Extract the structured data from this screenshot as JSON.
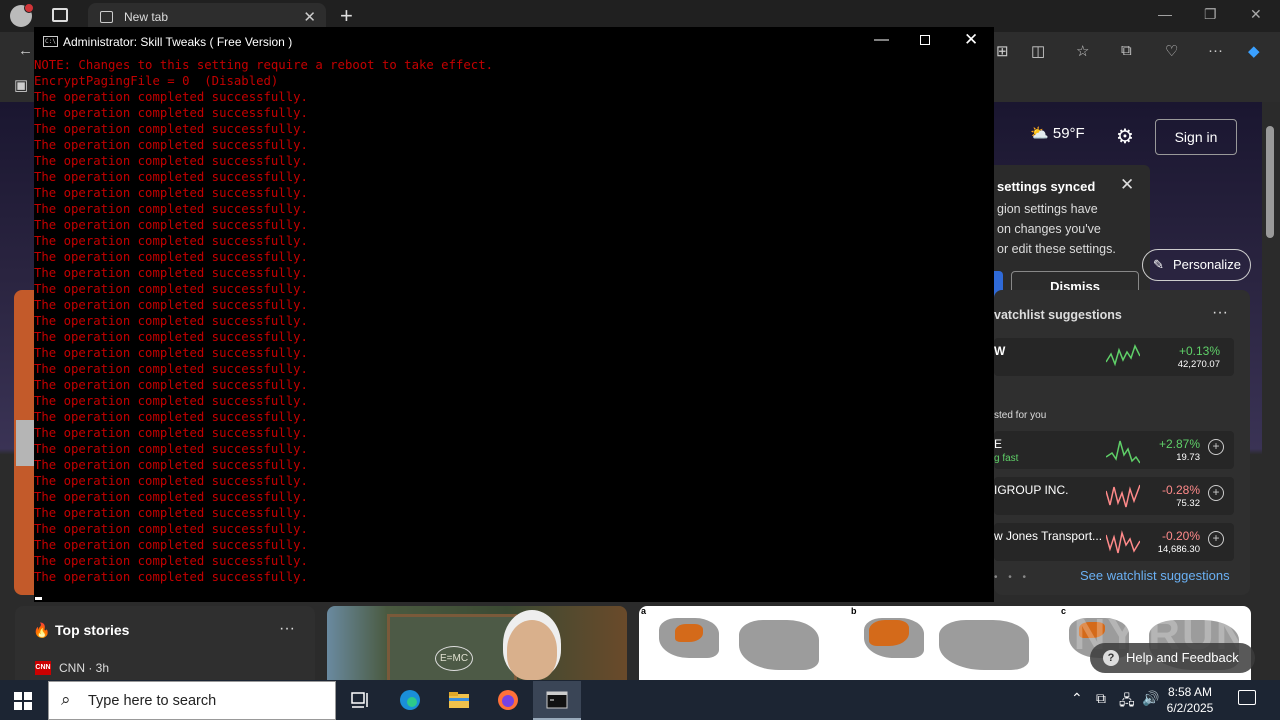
{
  "browser": {
    "tab_title": "New tab"
  },
  "ntp": {
    "weather_temp": "59°F",
    "signin_label": "Sign in",
    "popup": {
      "title_partial": "settings synced",
      "line1": "gion settings have",
      "line2": "on changes you've",
      "line3": " or edit these settings.",
      "dismiss_label": "Dismiss"
    },
    "personalize_label": "Personalize",
    "watchlist": {
      "title_partial": "vatchlist suggestions",
      "suggested_label": "sted for you",
      "see_more": "See watchlist suggestions",
      "items": [
        {
          "name": "W",
          "sub": "",
          "change": "+0.13%",
          "value": "42,270.07",
          "color": "#5fd068"
        },
        {
          "name": "E",
          "sub": "g fast",
          "change": "+2.87%",
          "value": "19.73",
          "color": "#5fd068"
        },
        {
          "name": "IGROUP INC.",
          "sub": "",
          "change": "-0.28%",
          "value": "75.32",
          "color": "#ff8a8a"
        },
        {
          "name": "w Jones Transport...",
          "sub": "",
          "change": "-0.20%",
          "value": "14,686.30",
          "color": "#ff8a8a"
        }
      ]
    },
    "top_stories": {
      "title": "Top stories",
      "source": "CNN · 3h",
      "source_logo": "CNN"
    },
    "einstein_text": "E=MC",
    "map_labels": [
      "a",
      "b",
      "c"
    ],
    "help_label": "Help and Feedback",
    "watermark": "ANY.RUN"
  },
  "console": {
    "title": "Administrator:  Skill Tweaks ( Free Version )",
    "icon_text": "C:\\",
    "lines": [
      "NOTE: Changes to this setting require a reboot to take effect.",
      "EncryptPagingFile = 0  (Disabled)",
      "The operation completed successfully.",
      "The operation completed successfully.",
      "The operation completed successfully.",
      "The operation completed successfully.",
      "The operation completed successfully.",
      "The operation completed successfully.",
      "The operation completed successfully.",
      "The operation completed successfully.",
      "The operation completed successfully.",
      "The operation completed successfully.",
      "The operation completed successfully.",
      "The operation completed successfully.",
      "The operation completed successfully.",
      "The operation completed successfully.",
      "The operation completed successfully.",
      "The operation completed successfully.",
      "The operation completed successfully.",
      "The operation completed successfully.",
      "The operation completed successfully.",
      "The operation completed successfully.",
      "The operation completed successfully.",
      "The operation completed successfully.",
      "The operation completed successfully.",
      "The operation completed successfully.",
      "The operation completed successfully.",
      "The operation completed successfully.",
      "The operation completed successfully.",
      "The operation completed successfully.",
      "The operation completed successfully.",
      "The operation completed successfully.",
      "The operation completed successfully."
    ],
    "text_color": "#c40000"
  },
  "taskbar": {
    "search_placeholder": "Type here to search",
    "time": "8:58 AM",
    "date": "6/2/2025"
  }
}
